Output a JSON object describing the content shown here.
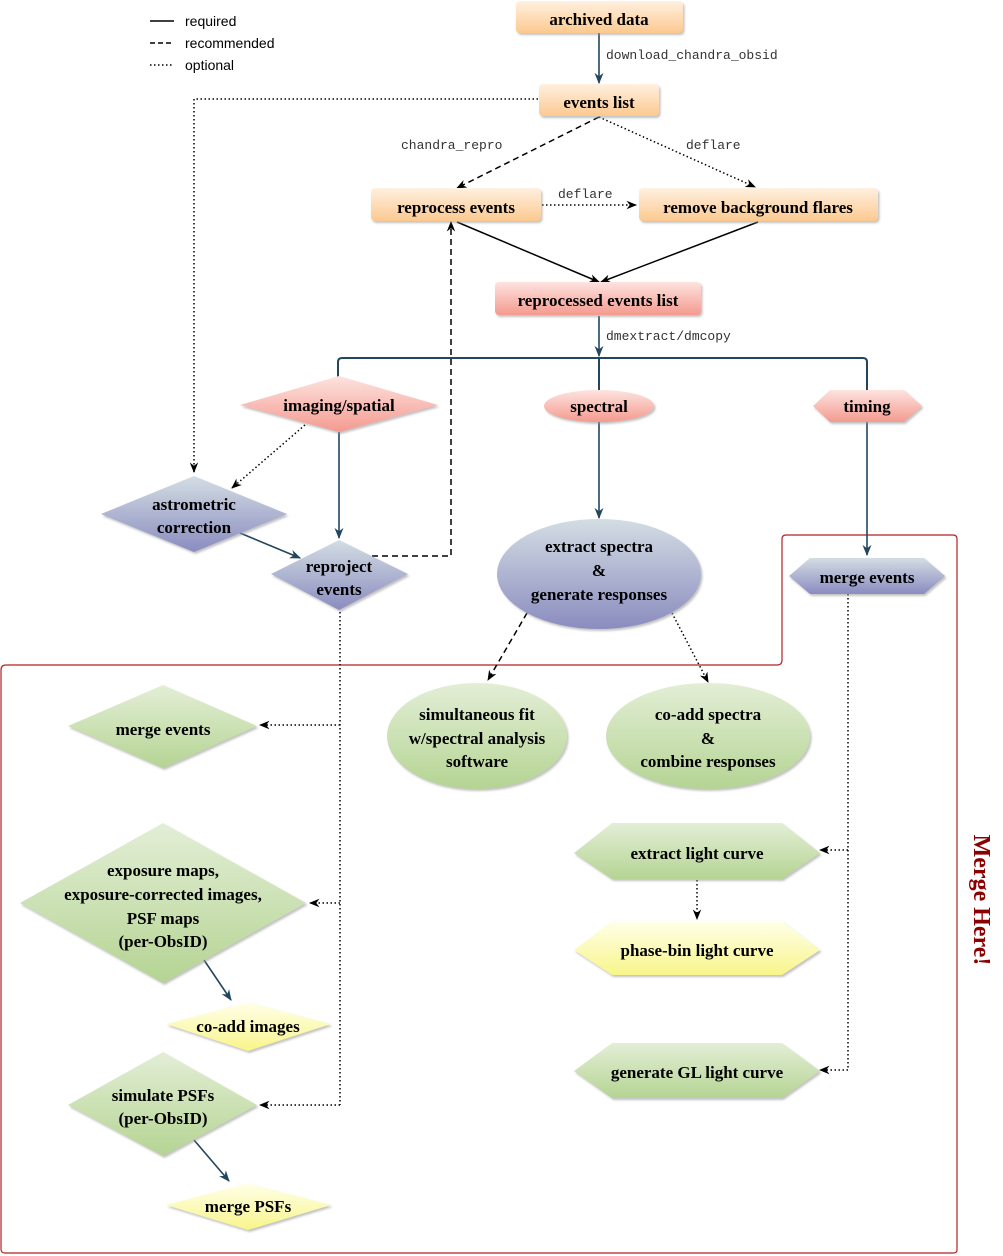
{
  "legend": {
    "required": "required",
    "recommended": "recommended",
    "optional": "optional"
  },
  "colors": {
    "orange_top": "#fff0e0",
    "orange_bottom": "#fcc990",
    "red_top": "#fde3df",
    "red_bottom": "#f49a8f",
    "blue_top": "#d3dde3",
    "blue_bottom": "#8a8cbf",
    "green_top": "#e3eed6",
    "green_bottom": "#b5d493",
    "yellow_top": "#ffffea",
    "yellow_bottom": "#f8f58a",
    "required_edge": "#23465f",
    "merge_box": "#b22222",
    "merge_text": "#8b0000"
  },
  "nodes": {
    "archived_data": "archived data",
    "events_list": "events list",
    "reprocess_events": "reprocess events",
    "remove_background_flares": "remove background flares",
    "reprocessed_events_list": "reprocessed events list",
    "imaging_spatial": "imaging/spatial",
    "spectral": "spectral",
    "timing": "timing",
    "astrometric_correction": [
      "astrometric",
      "correction"
    ],
    "reproject_events": [
      "reproject",
      "events"
    ],
    "extract_spectra": [
      "extract spectra",
      "&",
      "generate responses"
    ],
    "merge_events_timing": "merge events",
    "merge_events_imaging": "merge events",
    "simultaneous_fit": [
      "simultaneous fit",
      "w/spectral analysis",
      "software"
    ],
    "coadd_spectra": [
      "co-add spectra",
      "&",
      "combine responses"
    ],
    "exposure_maps": [
      "exposure maps,",
      "exposure-corrected images,",
      "PSF maps",
      "(per-ObsID)"
    ],
    "coadd_images": "co-add images",
    "simulate_psfs": [
      "simulate PSFs",
      "(per-ObsID)"
    ],
    "merge_psfs": "merge PSFs",
    "extract_light_curve": "extract light curve",
    "phase_bin_light_curve": "phase-bin light curve",
    "generate_gl_light_curve": "generate GL light curve"
  },
  "edge_labels": {
    "download": "download_chandra_obsid",
    "chandra_repro": "chandra_repro",
    "deflare_right": "deflare",
    "deflare_mid": "deflare",
    "dmextract": "dmextract/dmcopy"
  },
  "merge_region_label": "Merge Here!"
}
